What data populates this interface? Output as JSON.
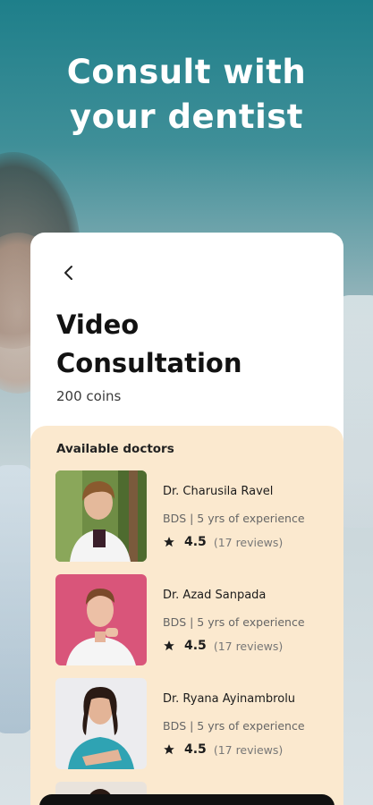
{
  "headline": {
    "line1": "Consult with",
    "line2": "your dentist"
  },
  "screen": {
    "back_icon": "chevron-left-icon",
    "title_line1": "Video",
    "title_line2": "Consultation",
    "price": "200 coins"
  },
  "doctors": {
    "heading": "Available doctors",
    "items": [
      {
        "name": "Dr. Charusila Ravel",
        "meta": "BDS | 5 yrs of experience",
        "rating": "4.5",
        "reviews": "(17 reviews)",
        "photo_bg": "#5b7a3d"
      },
      {
        "name": "Dr. Azad Sanpada",
        "meta": "BDS | 5 yrs of experience",
        "rating": "4.5",
        "reviews": "(17 reviews)",
        "photo_bg": "#d9557a"
      },
      {
        "name": "Dr. Ryana Ayinambrolu",
        "meta": "BDS | 5 yrs of experience",
        "rating": "4.5",
        "reviews": "(17 reviews)",
        "photo_bg": "#e9e9ec"
      }
    ]
  },
  "colors": {
    "accent_teal": "#1e7f8a",
    "panel": "#fbe9cf",
    "text_dark": "#121212"
  }
}
